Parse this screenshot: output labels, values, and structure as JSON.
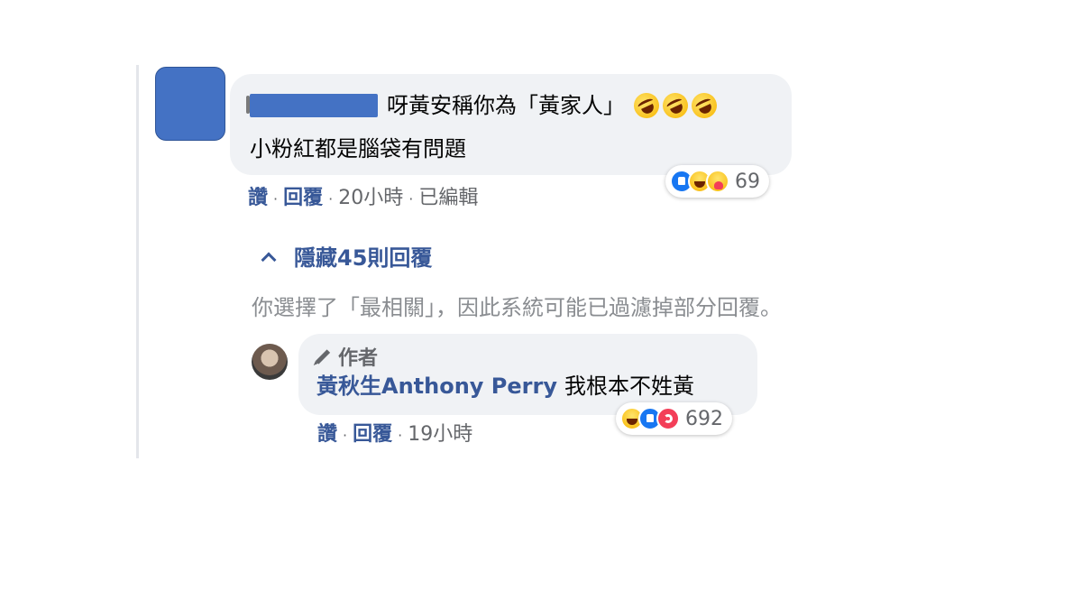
{
  "comment": {
    "text_line1": "呀黃安稱你為「黃家人」",
    "text_line2": "小粉紅都是腦袋有問題",
    "actions": {
      "like": "讚",
      "reply": "回覆",
      "time": "20小時",
      "edited": "已編輯"
    },
    "reactions": {
      "icons": [
        "like-icon",
        "haha-icon",
        "care-icon"
      ],
      "count": "69"
    }
  },
  "replies_toggle": {
    "label": "隱藏45則回覆",
    "icon": "chevron-up-icon"
  },
  "filter_note": "你選擇了「最相關」，因此系統可能已過濾掉部分回覆。",
  "reply": {
    "badge": "作者",
    "author": "黃秋生Anthony Perry",
    "text": "我根本不姓黃",
    "actions": {
      "like": "讚",
      "reply": "回覆",
      "time": "19小時"
    },
    "reactions": {
      "icons": [
        "haha-icon",
        "like-icon",
        "love-icon"
      ],
      "count": "692"
    }
  },
  "colors": {
    "link": "#385898",
    "meta": "#65676b",
    "bubble": "#f0f2f5",
    "redaction": "#4472c4"
  }
}
